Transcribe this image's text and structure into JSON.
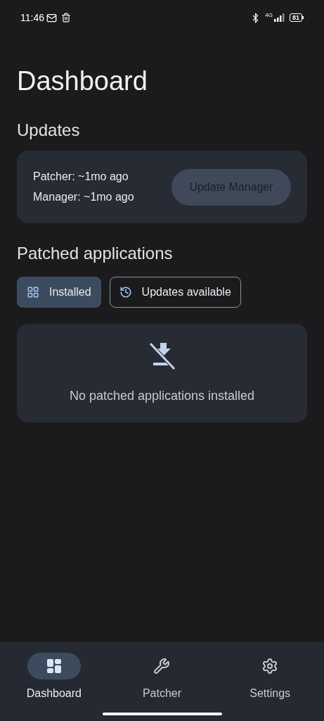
{
  "status_bar": {
    "time": "11:46",
    "network": "4G",
    "battery": "81"
  },
  "title": "Dashboard",
  "updates": {
    "heading": "Updates",
    "lines": [
      "Patcher: ~1mo ago",
      "Manager: ~1mo ago"
    ],
    "button": {
      "label": "Update Manager",
      "disabled": true
    }
  },
  "patched": {
    "heading": "Patched applications",
    "filters": [
      {
        "label": "Installed",
        "kind": "grid",
        "selected": true
      },
      {
        "label": "Updates available",
        "kind": "history",
        "selected": false
      }
    ],
    "empty_message": "No patched applications installed"
  },
  "nav": [
    {
      "label": "Dashboard",
      "kind": "dashboard",
      "selected": true
    },
    {
      "label": "Patcher",
      "kind": "wrench",
      "selected": false
    },
    {
      "label": "Settings",
      "kind": "settings",
      "selected": false
    }
  ]
}
